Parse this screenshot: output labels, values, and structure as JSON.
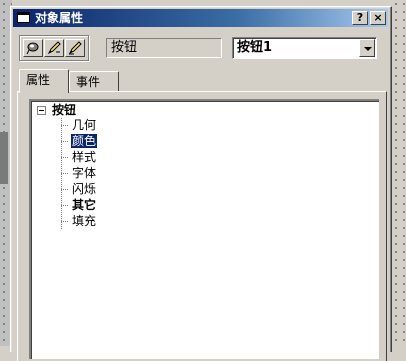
{
  "window": {
    "title": "对象属性",
    "help_button": "?",
    "close_button": "×"
  },
  "toolbar": {
    "tools": [
      {
        "icon": "pin-icon"
      },
      {
        "icon": "pencil-edit-icon"
      },
      {
        "icon": "pencil-props-icon"
      }
    ],
    "object_type_label": "按钮",
    "object_select": {
      "value": "按钮1"
    }
  },
  "tabs": [
    {
      "label": "属性",
      "active": true
    },
    {
      "label": "事件",
      "active": false
    }
  ],
  "tree": {
    "root": {
      "label": "按钮",
      "expanded": true
    },
    "items": [
      {
        "label": "几何",
        "selected": false,
        "bold": false
      },
      {
        "label": "颜色",
        "selected": true,
        "bold": false
      },
      {
        "label": "样式",
        "selected": false,
        "bold": false
      },
      {
        "label": "字体",
        "selected": false,
        "bold": false
      },
      {
        "label": "闪烁",
        "selected": false,
        "bold": false
      },
      {
        "label": "其它",
        "selected": false,
        "bold": true
      },
      {
        "label": "填充",
        "selected": false,
        "bold": false
      }
    ]
  },
  "colors": {
    "titlebar_start": "#0a246a",
    "titlebar_end": "#a6caf0",
    "selection": "#0a246a",
    "face": "#d4d0c8"
  }
}
